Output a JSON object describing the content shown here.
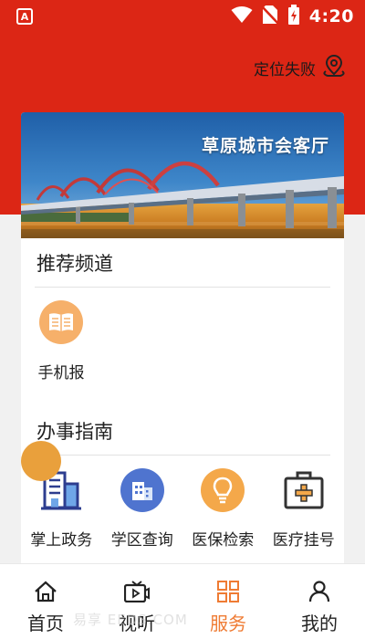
{
  "status_bar": {
    "time": "4:20",
    "app_icon_letter": "A"
  },
  "location": {
    "text": "定位失败",
    "icon": "location-pin-icon"
  },
  "banner": {
    "title": "草原城市会客厅"
  },
  "sections": {
    "recommended": {
      "title": "推荐频道",
      "items": [
        {
          "label": "手机报",
          "icon": "newspaper-icon",
          "color": "#f6b06a"
        }
      ]
    },
    "guide": {
      "title": "办事指南",
      "items": [
        {
          "label": "掌上政务",
          "icon": "government-building-icon",
          "color": "#2d3d8f"
        },
        {
          "label": "学区查询",
          "icon": "school-building-icon",
          "color": "#4f74cf"
        },
        {
          "label": "医保检索",
          "icon": "lightbulb-icon",
          "color": "#f4a84a"
        },
        {
          "label": "医疗挂号",
          "icon": "medical-kit-icon",
          "color": "#333333"
        }
      ]
    }
  },
  "bottom_nav": {
    "items": [
      {
        "label": "首页",
        "icon": "home-icon"
      },
      {
        "label": "视听",
        "icon": "video-icon"
      },
      {
        "label": "服务",
        "icon": "grid-icon"
      },
      {
        "label": "我的",
        "icon": "user-icon"
      }
    ],
    "active_index": 2
  },
  "watermark": "易享 EEDS.COM",
  "colors": {
    "brand_red": "#dc2615",
    "active": "#ef7b33"
  }
}
